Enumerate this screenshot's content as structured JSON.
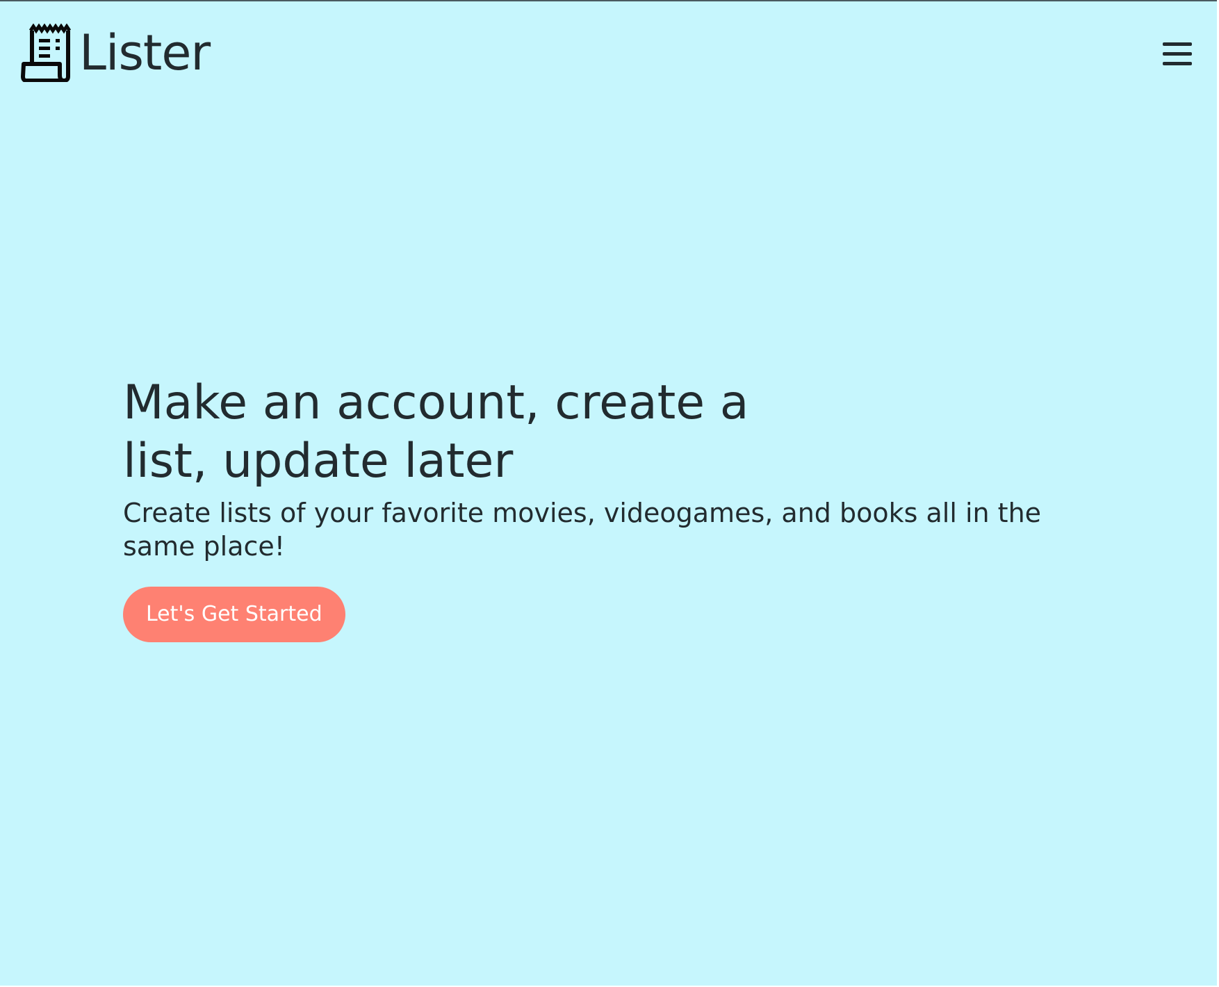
{
  "navbar": {
    "brand_name": "Lister",
    "logo_icon": "receipt-list-icon",
    "menu_icon": "hamburger-menu-icon"
  },
  "hero": {
    "title": "Make an account, create a list, update later",
    "subtitle": "Create lists of your favorite movies, videogames, and books all in the same place!",
    "cta_label": "Let's Get Started"
  },
  "colors": {
    "background": "#c6f6fd",
    "text": "#222b2f",
    "accent": "#fe8172",
    "button_text": "#ffffff"
  }
}
